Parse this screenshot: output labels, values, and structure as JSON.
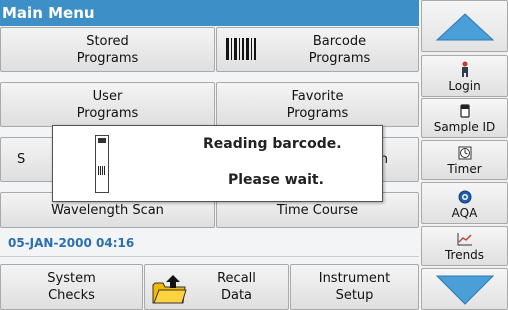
{
  "title": "Main Menu",
  "grid": {
    "stored_programs": "Stored\nPrograms",
    "barcode_programs": "Barcode\nPrograms",
    "user_programs": "User\nPrograms",
    "favorite_programs": "Favorite\nPrograms",
    "row3_left_fragment": "S",
    "row3_right_fragment": "n",
    "wavelength_scan": "Wavelength Scan",
    "time_course": "Time Course"
  },
  "status": {
    "datetime": "05-JAN-2000  04:16"
  },
  "bottom": {
    "system_checks": "System\nChecks",
    "recall_data": "Recall\nData",
    "instrument_setup": "Instrument\nSetup"
  },
  "side": {
    "login": "Login",
    "sample_id": "Sample ID",
    "timer": "Timer",
    "aqa": "AQA",
    "trends": "Trends"
  },
  "dialog": {
    "line1": "Reading barcode.",
    "line2": "Please wait."
  },
  "colors": {
    "titlebar": "#3d8fc7",
    "date": "#2a6fb0",
    "arrow": "#4a9fd8"
  },
  "icons": [
    "barcode-icon",
    "folder-upload-icon",
    "person-icon",
    "sample-vial-icon",
    "timer-icon",
    "aqa-icon",
    "trends-icon",
    "arrow-up-icon",
    "arrow-down-icon",
    "vial-barcode-icon"
  ]
}
